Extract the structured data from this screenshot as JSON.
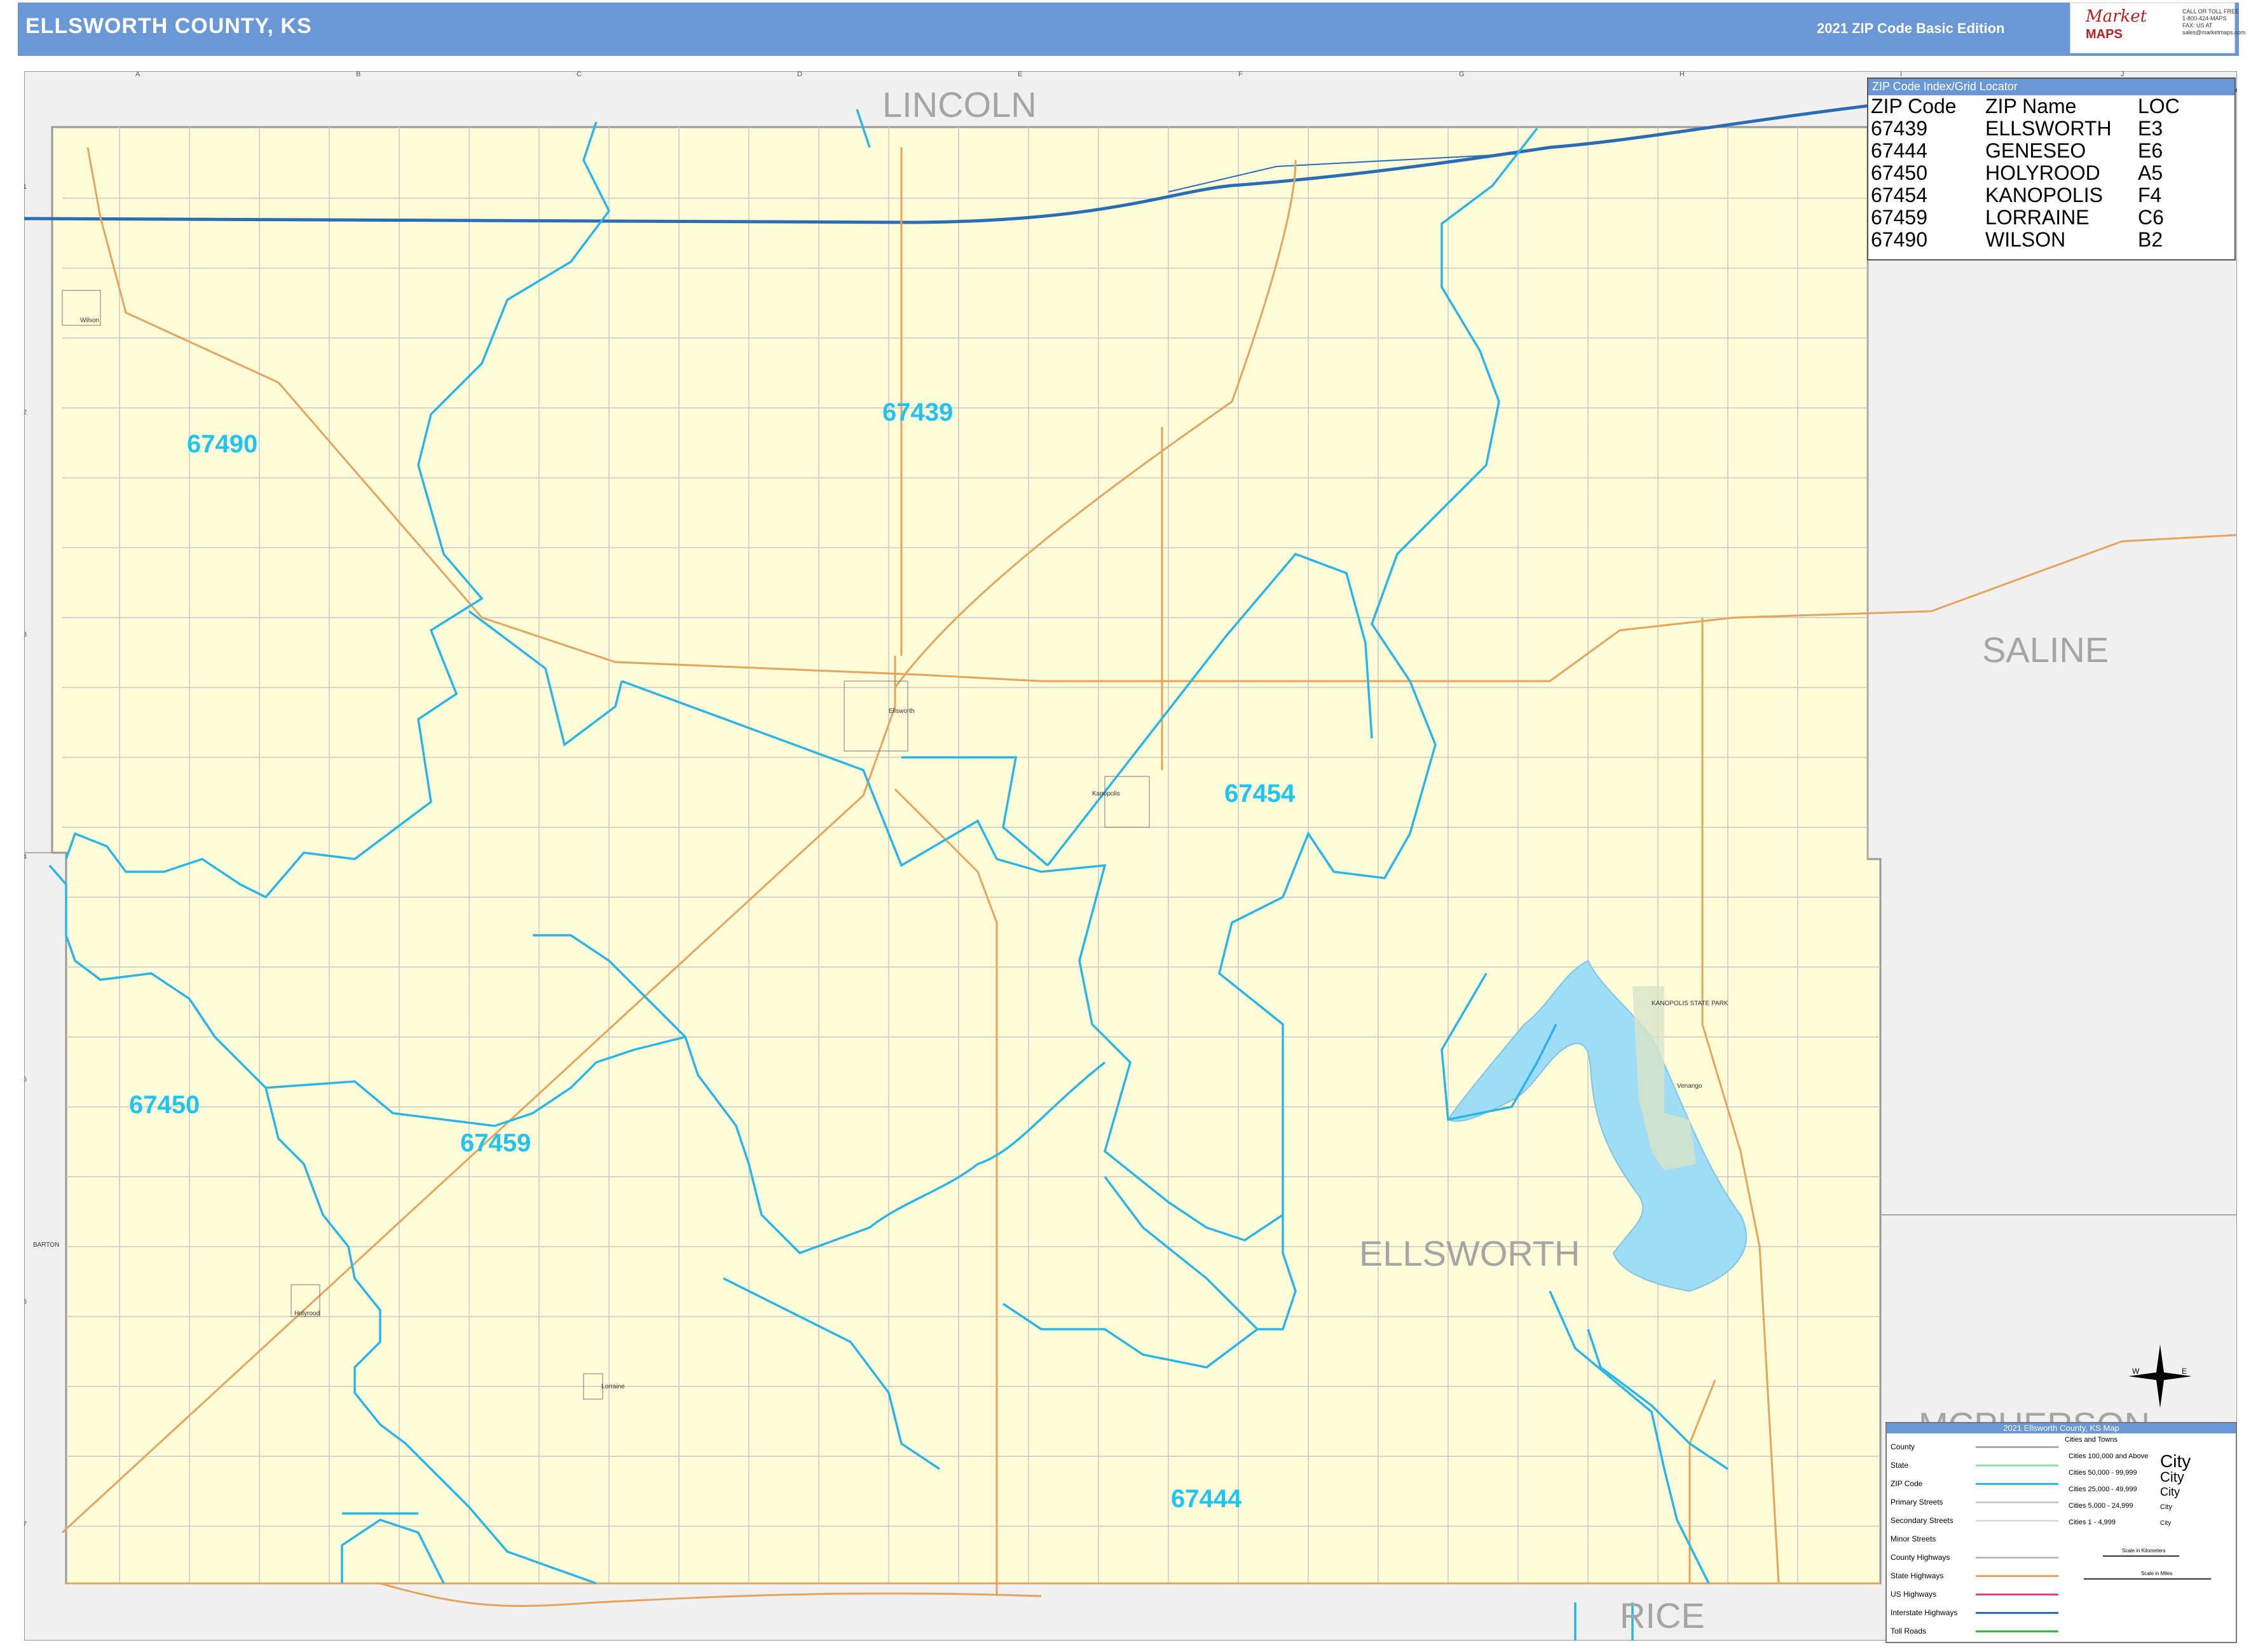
{
  "header": {
    "title": "ELLSWORTH COUNTY, KS",
    "edition": "2021 ZIP Code Basic Edition"
  },
  "logo": {
    "brand": "Market",
    "sub": "MAPS",
    "contact_lines": [
      "CALL OR TOLL FREE",
      "1-800-424-MAPS",
      "FAX: US AT",
      "sales@marketmaps.com"
    ]
  },
  "grid": {
    "columns": [
      "A",
      "B",
      "C",
      "D",
      "E",
      "F",
      "G",
      "H",
      "I",
      "J"
    ],
    "rows": [
      "1",
      "2",
      "3",
      "4",
      "5",
      "6",
      "7"
    ]
  },
  "neighbors": {
    "north": "LINCOLN",
    "east": "SALINE",
    "south": "RICE",
    "southeast": "MCPHERSON",
    "west": "BARTON"
  },
  "county_label": "ELLSWORTH",
  "zip_labels": [
    "67439",
    "67490",
    "67454",
    "67450",
    "67459",
    "67444"
  ],
  "towns": [
    "Wilson",
    "Ellsworth",
    "Kanopolis",
    "Holyrood",
    "Lorraine",
    "Venango"
  ],
  "park_label": "KANOPOLIS STATE PARK",
  "zip_index": {
    "header": "ZIP Code Index/Grid Locator",
    "columns": [
      "ZIP Code",
      "ZIP Name",
      "LOC"
    ],
    "rows": [
      [
        "67439",
        "ELLSWORTH",
        "E3"
      ],
      [
        "67444",
        "GENESEO",
        "E6"
      ],
      [
        "67450",
        "HOLYROOD",
        "A5"
      ],
      [
        "67454",
        "KANOPOLIS",
        "F4"
      ],
      [
        "67459",
        "LORRAINE",
        "C6"
      ],
      [
        "67490",
        "WILSON",
        "B2"
      ]
    ]
  },
  "legend": {
    "header": "2021 Ellsworth County, KS Map",
    "items": [
      "County",
      "State",
      "ZIP Code",
      "Primary Streets",
      "Secondary Streets",
      "Minor Streets",
      "County Highways",
      "State Highways",
      "US Highways",
      "Interstate Highways",
      "Toll Roads"
    ],
    "cities_header": "Cities and Towns",
    "cities": [
      [
        "Cities 100,000 and Above",
        "City"
      ],
      [
        "Cities 50,000 - 99,999",
        "City"
      ],
      [
        "Cities 25,000 - 49,999",
        "City"
      ],
      [
        "Cities 5,000 - 24,999",
        "City"
      ],
      [
        "Cities 1 - 4,999",
        "City"
      ]
    ],
    "scale_km": "Scale in Kilometers",
    "scale_mi": "Scale in Miles"
  },
  "compass": {
    "n": "N",
    "s": "S",
    "e": "E",
    "w": "W"
  },
  "colors": {
    "title_bar": "#6a97d6",
    "land": "#fefcd9",
    "outside": "#f0f0f0",
    "zip_boundary": "#29b6e6",
    "interstate": "#2a6db5",
    "state_hwy": "#e6a35a",
    "water": "#9fdcf5"
  }
}
